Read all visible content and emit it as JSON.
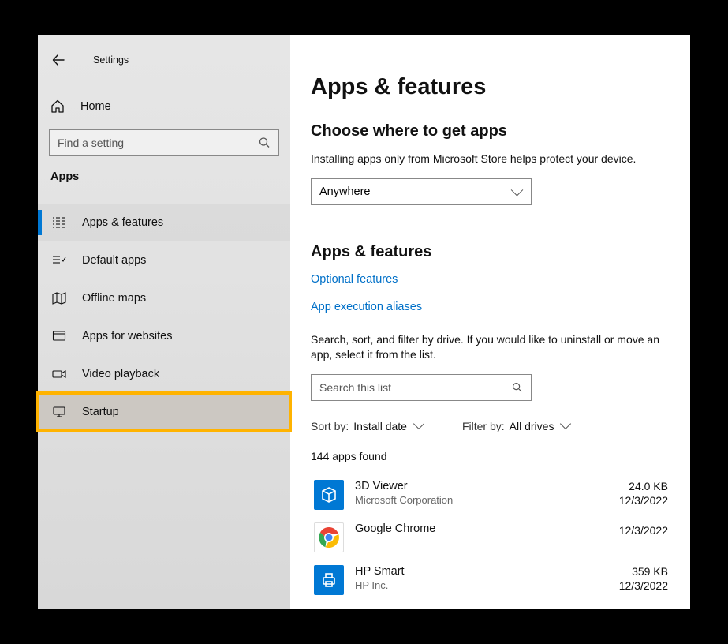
{
  "header": {
    "window_title": "Settings"
  },
  "sidebar": {
    "home_label": "Home",
    "search_placeholder": "Find a setting",
    "category_title": "Apps",
    "items": [
      {
        "icon": "apps-features-icon",
        "label": "Apps & features",
        "active": true
      },
      {
        "icon": "default-apps-icon",
        "label": "Default apps"
      },
      {
        "icon": "offline-maps-icon",
        "label": "Offline maps"
      },
      {
        "icon": "apps-websites-icon",
        "label": "Apps for websites"
      },
      {
        "icon": "video-playback-icon",
        "label": "Video playback"
      },
      {
        "icon": "startup-icon",
        "label": "Startup",
        "highlight": true
      }
    ]
  },
  "main": {
    "page_title": "Apps & features",
    "choose_heading": "Choose where to get apps",
    "choose_help": "Installing apps only from Microsoft Store helps protect your device.",
    "choose_value": "Anywhere",
    "af_heading": "Apps & features",
    "link_optional": "Optional features",
    "link_aliases": "App execution aliases",
    "search_help": "Search, sort, and filter by drive. If you would like to uninstall or move an app, select it from the list.",
    "search_placeholder": "Search this list",
    "sort_label": "Sort by:",
    "sort_value": "Install date",
    "filter_label": "Filter by:",
    "filter_value": "All drives",
    "found_text": "144 apps found",
    "apps": [
      {
        "name": "3D Viewer",
        "publisher": "Microsoft Corporation",
        "size": "24.0 KB",
        "date": "12/3/2022",
        "icon": "cube-icon",
        "bg": "#0078d4"
      },
      {
        "name": "Google Chrome",
        "publisher": "",
        "size": "",
        "date": "12/3/2022",
        "icon": "chrome-icon",
        "bg": "#ffffff"
      },
      {
        "name": "HP Smart",
        "publisher": "HP Inc.",
        "size": "359 KB",
        "date": "12/3/2022",
        "icon": "printer-icon",
        "bg": "#0078d4"
      }
    ]
  }
}
